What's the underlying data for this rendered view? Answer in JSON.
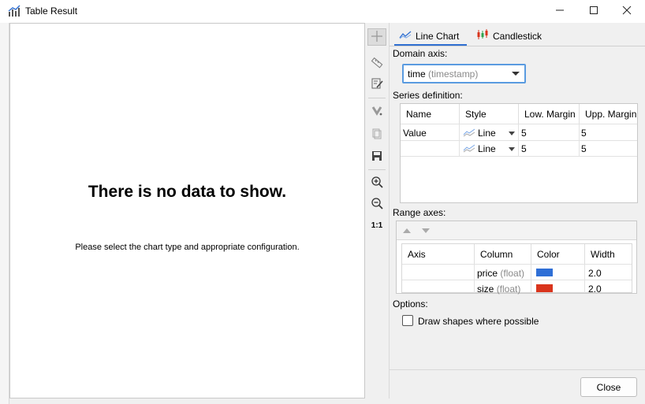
{
  "window": {
    "title": "Table Result",
    "minimize_icon": "minimize-icon",
    "maximize_icon": "maximize-icon",
    "close_icon": "close-icon"
  },
  "canvas": {
    "title": "There is no data to show.",
    "subtitle": "Please select the chart type and appropriate configuration."
  },
  "toolbar": {
    "icons": [
      "crosshair-icon",
      "ruler-icon",
      "edit-icon",
      "magnet-icon",
      "copy-icon",
      "save-icon",
      "zoom-in-icon",
      "zoom-out-icon",
      "zoom-reset-icon"
    ],
    "zoom_reset_label": "1:1"
  },
  "tabs": [
    {
      "label": "Line Chart",
      "icon": "line-chart-icon",
      "active": true
    },
    {
      "label": "Candlestick",
      "icon": "candlestick-icon",
      "active": false
    }
  ],
  "domain": {
    "label": "Domain axis:",
    "value": "time",
    "type": "(timestamp)"
  },
  "series": {
    "label": "Series definition:",
    "columns": [
      "Name",
      "Style",
      "Low. Margin",
      "Upp. Margin"
    ],
    "rows": [
      {
        "name": "Value",
        "style": "Line",
        "low": "5",
        "upp": "5"
      },
      {
        "name": "",
        "style": "Line",
        "low": "5",
        "upp": "5"
      }
    ]
  },
  "range": {
    "label": "Range axes:",
    "columns": [
      "Axis",
      "Column",
      "Color",
      "Width"
    ],
    "rows": [
      {
        "axis": "",
        "column": "price",
        "type": "(float)",
        "color": "#2f6fd6",
        "width": "2.0"
      },
      {
        "axis": "",
        "column": "size",
        "type": "(float)",
        "color": "#d9341c",
        "width": "2.0"
      }
    ]
  },
  "options": {
    "label": "Options:",
    "draw_shapes_label": "Draw shapes where possible",
    "draw_shapes_checked": false
  },
  "buttons": {
    "close_label": "Close"
  }
}
